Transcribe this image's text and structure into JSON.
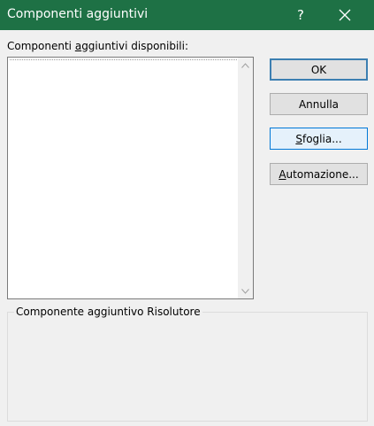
{
  "window": {
    "title": "Componenti aggiuntivi",
    "help_label": "?",
    "title_bar_color": "#1e7145"
  },
  "addins_list": {
    "label_before": "Componenti ",
    "label_access_key": "a",
    "label_after": "ggiuntivi disponibili:",
    "items": []
  },
  "buttons": {
    "ok": {
      "label": "OK"
    },
    "cancel": {
      "label": "Annulla"
    },
    "browse": {
      "access_key": "S",
      "rest": "foglia..."
    },
    "automation": {
      "access_key": "A",
      "rest": "utomazione..."
    }
  },
  "description_group": {
    "title": "Componente aggiuntivo Risolutore",
    "description": ""
  }
}
